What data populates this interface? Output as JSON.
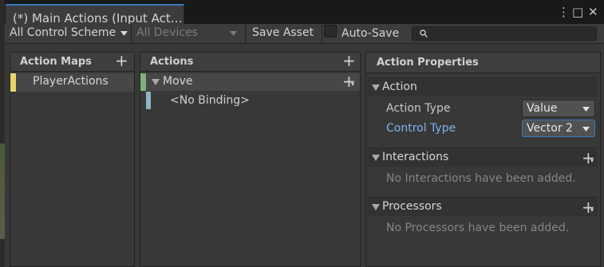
{
  "window": {
    "tab_title": "(*) Main Actions (Input Act…",
    "menu_icon": "⋮",
    "maximize_icon": "□",
    "close_icon": "✕"
  },
  "toolbar": {
    "control_scheme": "All Control Scheme",
    "devices": "All Devices",
    "save_asset": "Save Asset",
    "auto_save_label": "Auto-Save",
    "auto_save_checked": false,
    "search_value": ""
  },
  "action_maps": {
    "header": "Action Maps",
    "items": [
      {
        "label": "PlayerActions",
        "color": "#e8d46a",
        "selected": true
      }
    ]
  },
  "actions": {
    "header": "Actions",
    "items": [
      {
        "label": "Move",
        "color": "#7fb07a",
        "expanded": true,
        "bindings": [
          {
            "label": "<No Binding>",
            "color": "#8fb4c4"
          }
        ]
      }
    ]
  },
  "properties": {
    "header": "Action Properties",
    "action_section": "Action",
    "action_type_label": "Action Type",
    "action_type_value": "Value",
    "control_type_label": "Control Type",
    "control_type_value": "Vector 2",
    "interactions_section": "Interactions",
    "interactions_empty": "No Interactions have been added.",
    "processors_section": "Processors",
    "processors_empty": "No Processors have been added."
  },
  "colors": {
    "accent_blue": "#3a79bb",
    "link_blue": "#7fb3ee",
    "action_map_marker": "#e8d46a",
    "action_marker": "#7fb07a",
    "binding_marker": "#8fb4c4"
  }
}
